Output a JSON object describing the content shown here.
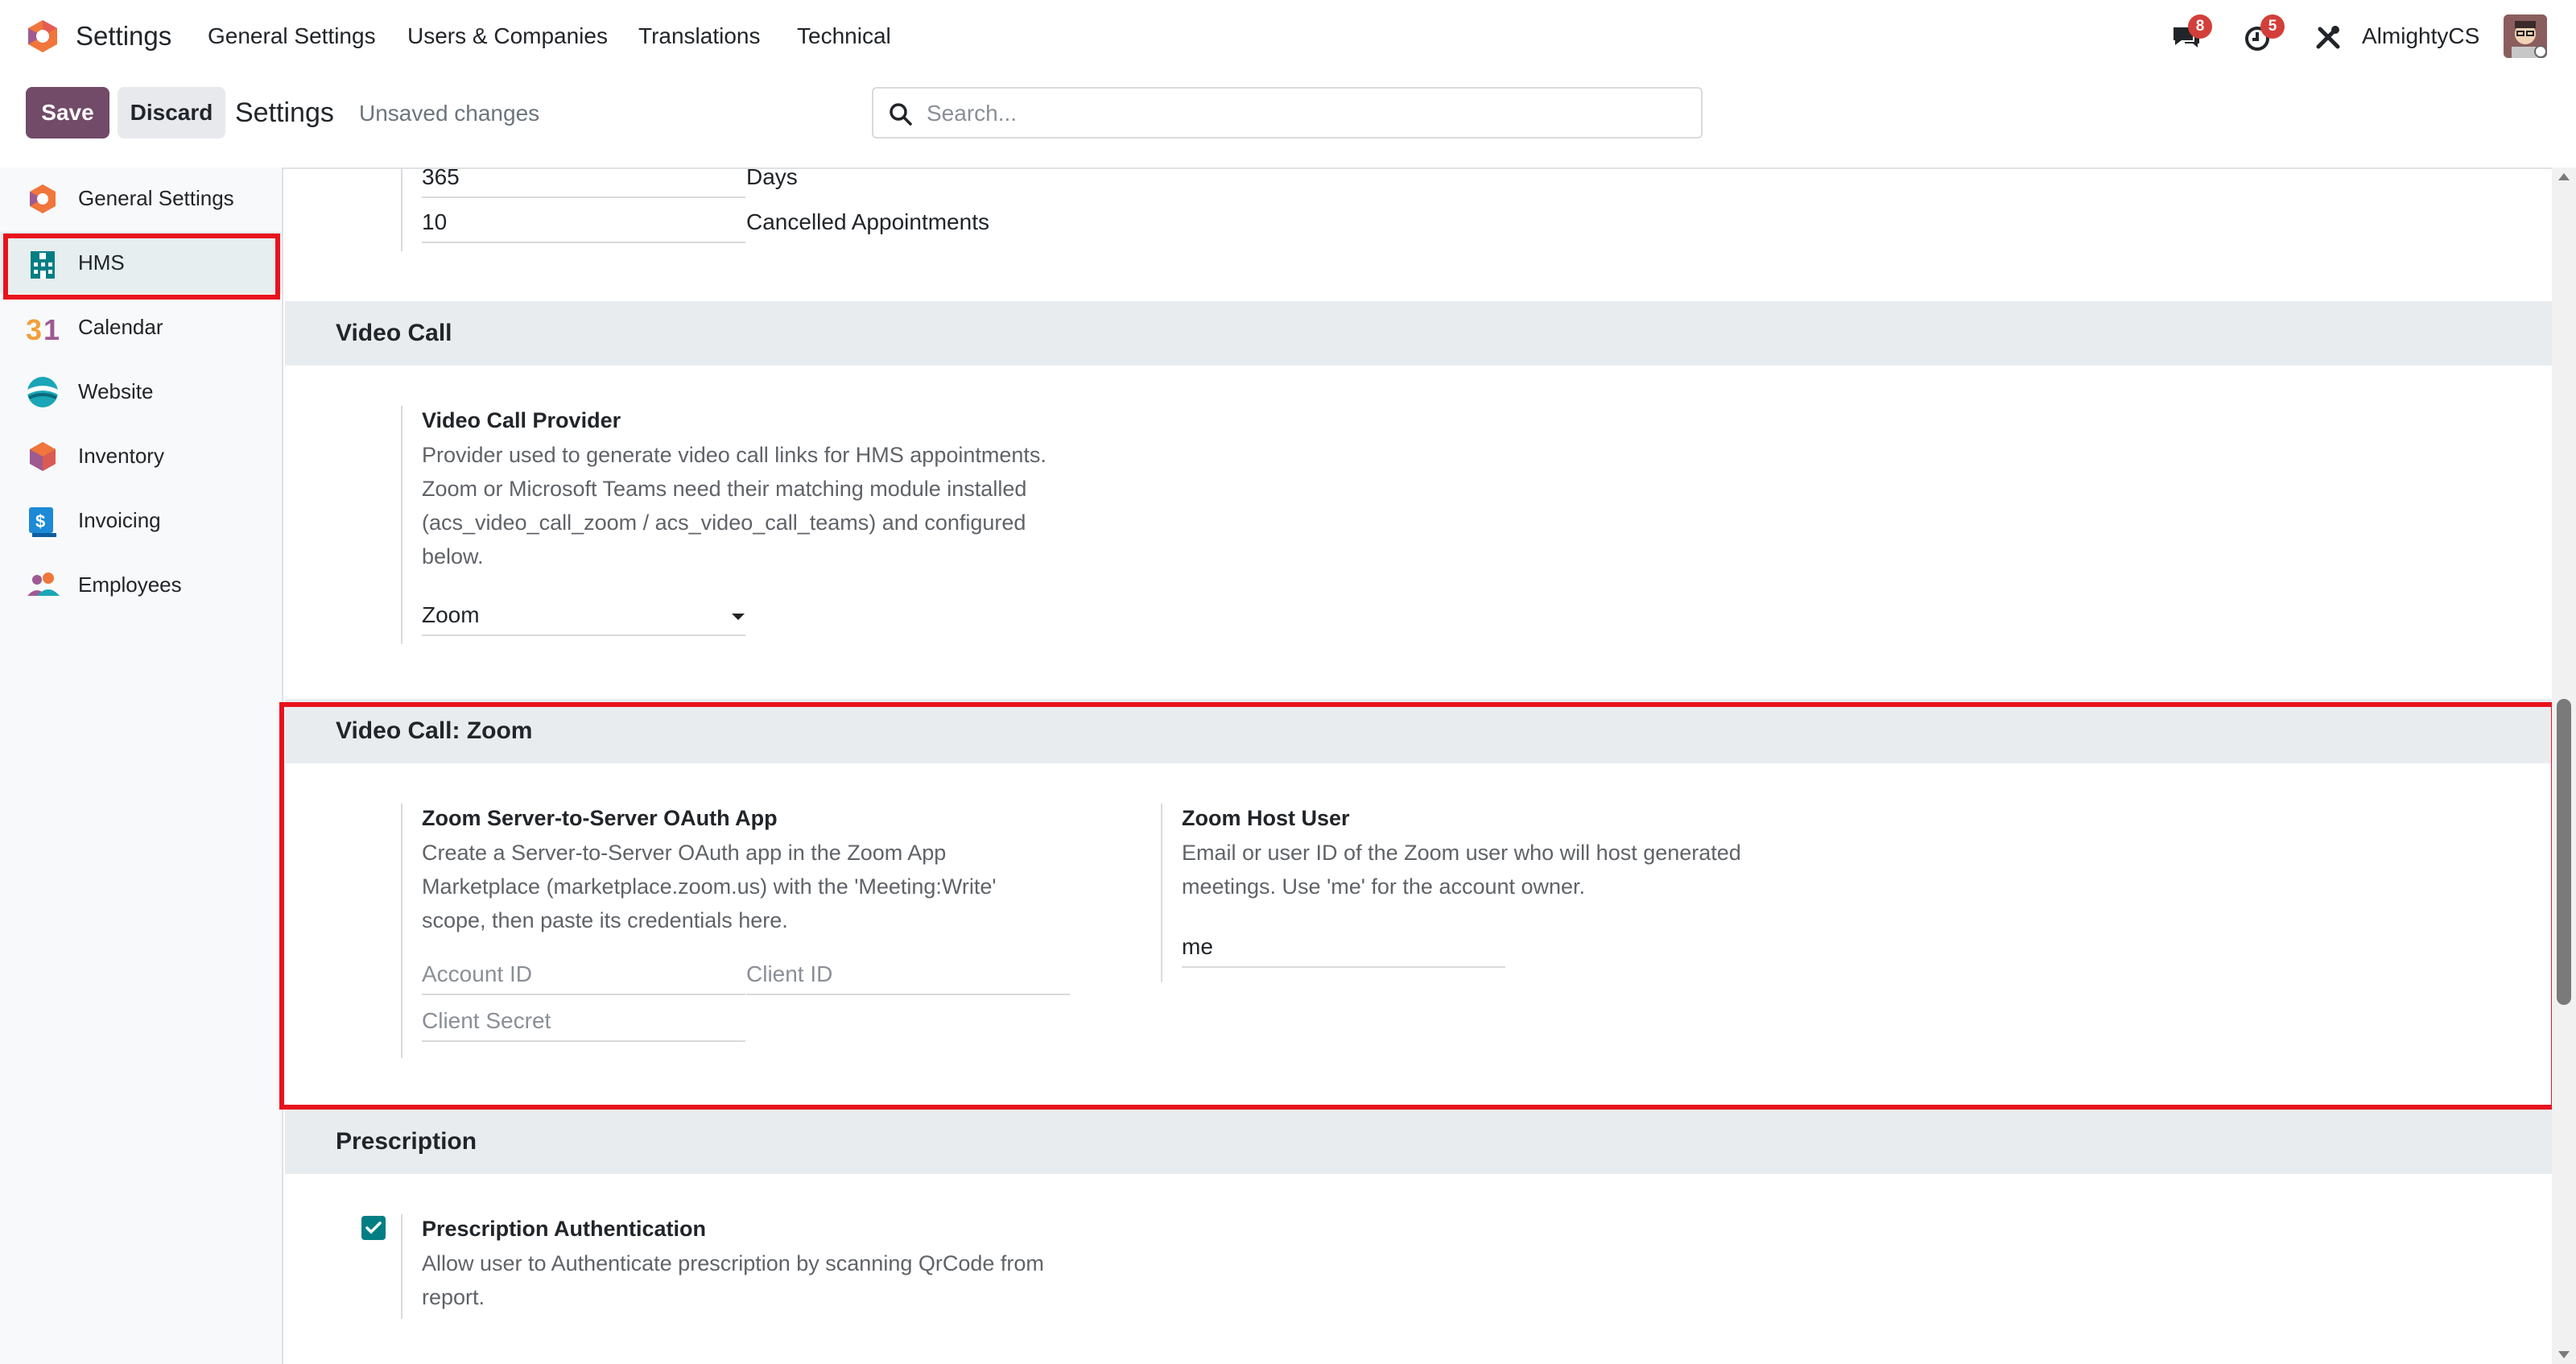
{
  "topbar": {
    "app_title": "Settings",
    "menu": [
      "General Settings",
      "Users & Companies",
      "Translations",
      "Technical"
    ],
    "messages_count": "8",
    "activities_count": "5",
    "user_name": "AlmightyCS"
  },
  "controlbar": {
    "save_label": "Save",
    "discard_label": "Discard",
    "breadcrumb": "Settings",
    "status": "Unsaved changes",
    "search_placeholder": "Search..."
  },
  "sidebar": {
    "items": [
      {
        "label": "General Settings",
        "icon": "odoo-logo-icon"
      },
      {
        "label": "HMS",
        "icon": "hospital-icon"
      },
      {
        "label": "Calendar",
        "icon": "calendar-icon"
      },
      {
        "label": "Website",
        "icon": "website-icon"
      },
      {
        "label": "Inventory",
        "icon": "inventory-icon"
      },
      {
        "label": "Invoicing",
        "icon": "invoicing-icon"
      },
      {
        "label": "Employees",
        "icon": "employees-icon"
      }
    ],
    "active": "HMS"
  },
  "content": {
    "top_rows": [
      {
        "value": "365",
        "unit": "Days"
      },
      {
        "value": "10",
        "unit": "Cancelled Appointments"
      }
    ],
    "video_call": {
      "heading": "Video Call",
      "provider_title": "Video Call Provider",
      "provider_desc": [
        "Provider used to generate video call links for HMS appointments.",
        "Zoom or Microsoft Teams need their matching module installed",
        "(acs_video_call_zoom / acs_video_call_teams) and configured",
        "below."
      ],
      "provider_value": "Zoom"
    },
    "zoom": {
      "heading": "Video Call: Zoom",
      "oauth_title": "Zoom Server-to-Server OAuth App",
      "oauth_desc": [
        "Create a Server-to-Server OAuth app in the Zoom App",
        "Marketplace (marketplace.zoom.us) with the 'Meeting:Write'",
        "scope, then paste its credentials here."
      ],
      "account_id_placeholder": "Account ID",
      "client_id_placeholder": "Client ID",
      "client_secret_placeholder": "Client Secret",
      "host_title": "Zoom Host User",
      "host_desc": [
        "Email or user ID of the Zoom user who will host generated",
        "meetings. Use 'me' for the account owner."
      ],
      "host_value": "me"
    },
    "prescription": {
      "heading": "Prescription",
      "auth_title": "Prescription Authentication",
      "auth_desc": [
        "Allow user to Authenticate prescription by scanning QrCode from",
        "report."
      ],
      "auth_checked": true
    }
  },
  "colors": {
    "brand": "#714b67",
    "accent": "#017e84",
    "highlight": "#e8121d",
    "badge": "#d23f3a"
  }
}
